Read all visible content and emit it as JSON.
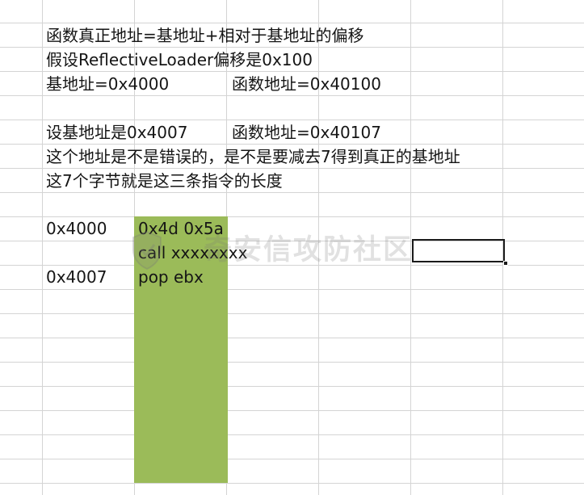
{
  "notes": {
    "line1": "函数真正地址=基地址+相对于基地址的偏移",
    "line2": "假设ReflectiveLoader偏移是0x100",
    "line3_a": "基地址=0x4000",
    "line3_b": "函数地址=0x40100",
    "line4_a": "设基地址是0x4007",
    "line4_b": "函数地址=0x40107",
    "line5": "这个地址是不是错误的，是不是要减去7得到真正的基地址",
    "line6": "这7个字节就是这三条指令的长度"
  },
  "memory": {
    "addr1": "0x4000",
    "addr2": "0x4007",
    "instr1": "0x4d 0x5a",
    "instr2": "call xxxxxxxx",
    "instr3": "pop ebx",
    "block_color": "#9bbb59"
  },
  "watermark": {
    "text": "奇安信攻防社区",
    "icon": "shield-logo-icon"
  },
  "selection": {
    "border_color": "#1a1a1a"
  }
}
